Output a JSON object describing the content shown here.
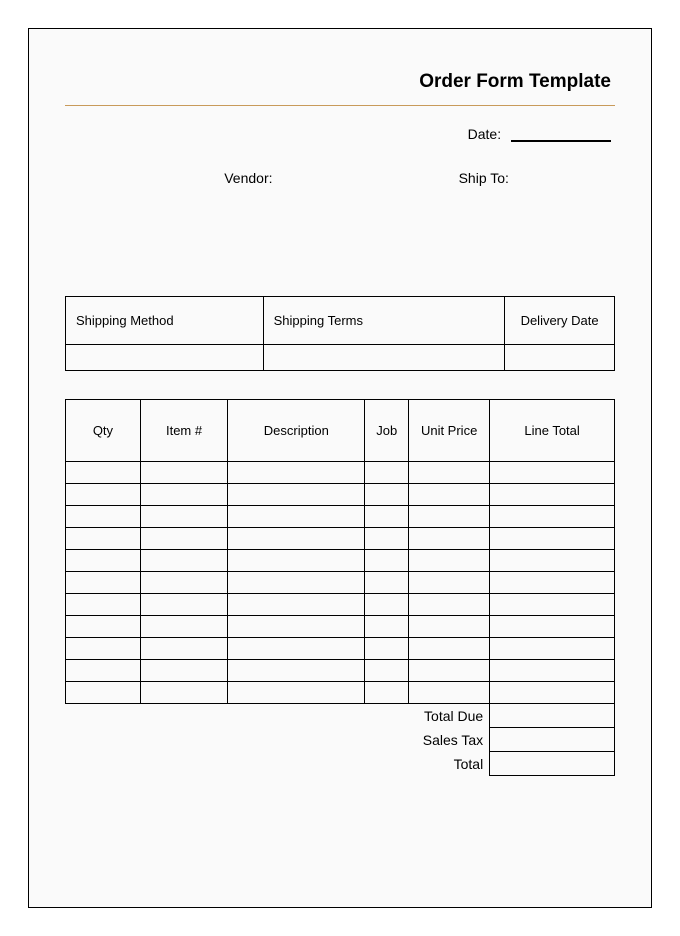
{
  "header": {
    "title": "Order Form Template",
    "date_label": "Date:"
  },
  "parties": {
    "vendor_label": "Vendor:",
    "shipto_label": "Ship To:"
  },
  "shipping": {
    "method_label": "Shipping Method",
    "terms_label": "Shipping Terms",
    "delivery_label": "Delivery Date"
  },
  "items": {
    "qty_label": "Qty",
    "item_label": "Item #",
    "desc_label": "Description",
    "job_label": "Job",
    "unit_label": "Unit Price",
    "line_label": "Line Total"
  },
  "totals": {
    "total_due_label": "Total Due",
    "sales_tax_label": "Sales Tax",
    "total_label": "Total"
  }
}
